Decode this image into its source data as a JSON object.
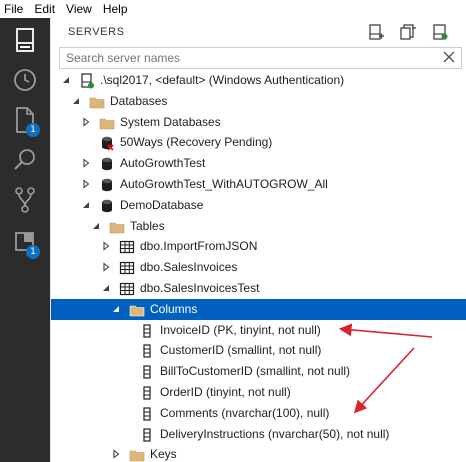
{
  "menu": [
    "File",
    "Edit",
    "View",
    "Help"
  ],
  "activity": {
    "badges": {
      "explorer": "1",
      "extensions": "1"
    }
  },
  "panel": {
    "title": "SERVERS",
    "search_placeholder": "Search server names"
  },
  "colors": {
    "activity_bg": "#2c2c2c",
    "selection": "#0060c0",
    "badge": "#0e70c0",
    "annotation_arrow": "#d9232d",
    "folder": "#dcb67a"
  },
  "tree": [
    {
      "label": ".\\sql2017, <default> (Windows Authentication)",
      "icon": "server-icon",
      "twisty": "expanded"
    },
    {
      "label": "Databases",
      "icon": "folder-icon",
      "twisty": "expanded"
    },
    {
      "label": "System Databases",
      "icon": "folder-icon",
      "twisty": "collapsed"
    },
    {
      "label": "50Ways (Recovery Pending)",
      "icon": "database-error-icon",
      "twisty": "none"
    },
    {
      "label": "AutoGrowthTest",
      "icon": "database-icon",
      "twisty": "collapsed"
    },
    {
      "label": "AutoGrowthTest_WithAUTOGROW_All",
      "icon": "database-icon",
      "twisty": "collapsed"
    },
    {
      "label": "DemoDatabase",
      "icon": "database-icon",
      "twisty": "expanded"
    },
    {
      "label": "Tables",
      "icon": "folder-icon",
      "twisty": "expanded"
    },
    {
      "label": "dbo.ImportFromJSON",
      "icon": "table-icon",
      "twisty": "collapsed"
    },
    {
      "label": "dbo.SalesInvoices",
      "icon": "table-icon",
      "twisty": "collapsed"
    },
    {
      "label": "dbo.SalesInvoicesTest",
      "icon": "table-icon",
      "twisty": "expanded"
    },
    {
      "label": "Columns",
      "icon": "folder-icon",
      "twisty": "expanded",
      "selected": true
    },
    {
      "label": "InvoiceID (PK, tinyint, not null)",
      "icon": "column-icon",
      "twisty": "none"
    },
    {
      "label": "CustomerID (smallint, not null)",
      "icon": "column-icon",
      "twisty": "none"
    },
    {
      "label": "BillToCustomerID (smallint, not null)",
      "icon": "column-icon",
      "twisty": "none"
    },
    {
      "label": "OrderID (tinyint, not null)",
      "icon": "column-icon",
      "twisty": "none"
    },
    {
      "label": "Comments (nvarchar(100), null)",
      "icon": "column-icon",
      "twisty": "none"
    },
    {
      "label": "DeliveryInstructions (nvarchar(50), not null)",
      "icon": "column-icon",
      "twisty": "none"
    },
    {
      "label": "Keys",
      "icon": "folder-icon",
      "twisty": "collapsed"
    }
  ]
}
